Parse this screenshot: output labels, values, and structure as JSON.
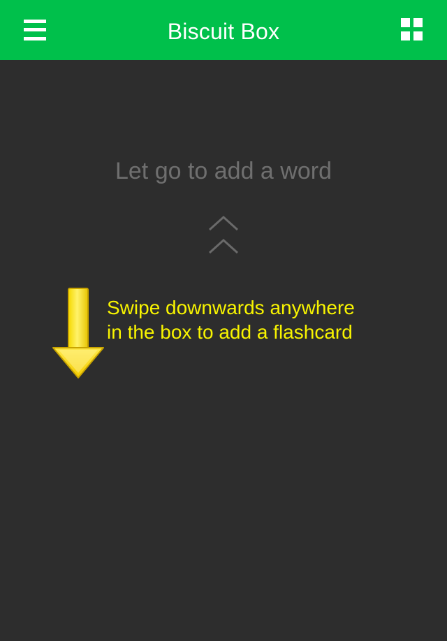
{
  "header": {
    "title": "Biscuit Box",
    "menu_icon": "hamburger-menu-icon",
    "grid_icon": "grid-view-icon",
    "background": "#00c04b"
  },
  "main": {
    "hint": "Let go to add a word",
    "chevron_icon": "double-chevron-up-icon",
    "background": "#2d2d2d"
  },
  "tutorial": {
    "arrow_icon": "down-arrow-icon",
    "line1": "Swipe downwards anywhere",
    "line2": "in the box to add a flashcard",
    "text_color": "#f8f400"
  }
}
